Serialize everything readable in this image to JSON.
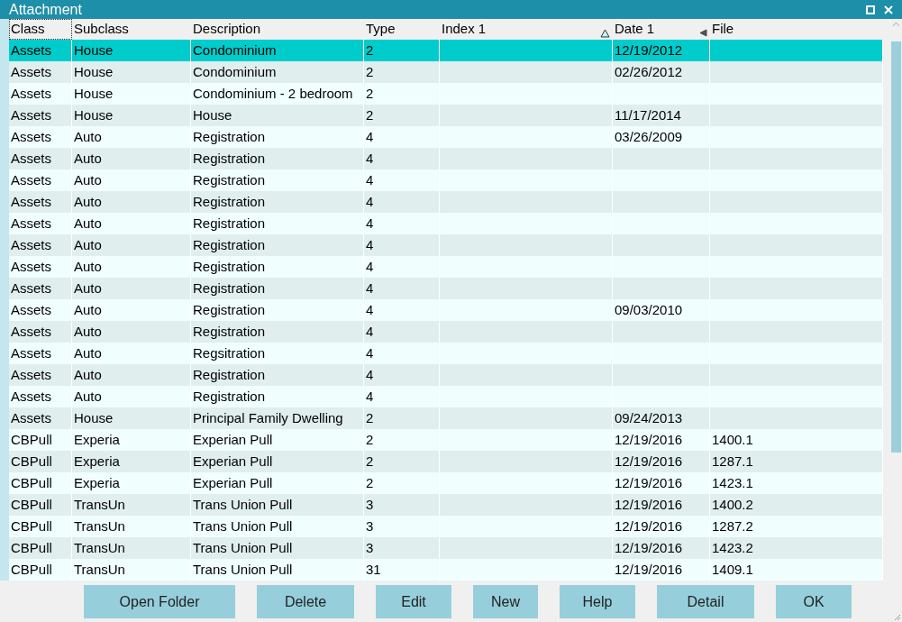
{
  "window": {
    "title": "Attachment"
  },
  "table": {
    "columns": [
      {
        "label": "Class",
        "sorted_ascending": false,
        "marked": false
      },
      {
        "label": "Subclass",
        "sorted_ascending": false,
        "marked": false
      },
      {
        "label": "Description",
        "sorted_ascending": false,
        "marked": false
      },
      {
        "label": "Type",
        "sorted_ascending": false,
        "marked": false
      },
      {
        "label": "Index 1",
        "sorted_ascending": true,
        "marked": false
      },
      {
        "label": "Date 1",
        "sorted_ascending": false,
        "marked": true
      },
      {
        "label": "File",
        "sorted_ascending": false,
        "marked": false
      }
    ],
    "rows": [
      {
        "selected": true,
        "cells": [
          "Assets",
          "House",
          "Condominium",
          "2",
          "",
          "12/19/2012",
          ""
        ]
      },
      {
        "selected": false,
        "cells": [
          "Assets",
          "House",
          "Condominium",
          "2",
          "",
          "02/26/2012",
          ""
        ]
      },
      {
        "selected": false,
        "cells": [
          "Assets",
          "House",
          "Condominium - 2 bedroom",
          "2",
          "",
          "",
          ""
        ]
      },
      {
        "selected": false,
        "cells": [
          "Assets",
          "House",
          "House",
          "2",
          "",
          "11/17/2014",
          ""
        ]
      },
      {
        "selected": false,
        "cells": [
          "Assets",
          "Auto",
          "Registration",
          "4",
          "",
          "03/26/2009",
          ""
        ]
      },
      {
        "selected": false,
        "cells": [
          "Assets",
          "Auto",
          "Registration",
          "4",
          "",
          "",
          ""
        ]
      },
      {
        "selected": false,
        "cells": [
          "Assets",
          "Auto",
          "Registration",
          "4",
          "",
          "",
          ""
        ]
      },
      {
        "selected": false,
        "cells": [
          "Assets",
          "Auto",
          "Registration",
          "4",
          "",
          "",
          ""
        ]
      },
      {
        "selected": false,
        "cells": [
          "Assets",
          "Auto",
          "Registration",
          "4",
          "",
          "",
          ""
        ]
      },
      {
        "selected": false,
        "cells": [
          "Assets",
          "Auto",
          "Registration",
          "4",
          "",
          "",
          ""
        ]
      },
      {
        "selected": false,
        "cells": [
          "Assets",
          "Auto",
          "Registration",
          "4",
          "",
          "",
          ""
        ]
      },
      {
        "selected": false,
        "cells": [
          "Assets",
          "Auto",
          "Registration",
          "4",
          "",
          "",
          ""
        ]
      },
      {
        "selected": false,
        "cells": [
          "Assets",
          "Auto",
          "Registration",
          "4",
          "",
          "09/03/2010",
          ""
        ]
      },
      {
        "selected": false,
        "cells": [
          "Assets",
          "Auto",
          "Registration",
          "4",
          "",
          "",
          ""
        ]
      },
      {
        "selected": false,
        "cells": [
          "Assets",
          "Auto",
          "Regsitration",
          "4",
          "",
          "",
          ""
        ]
      },
      {
        "selected": false,
        "cells": [
          "Assets",
          "Auto",
          "Registration",
          "4",
          "",
          "",
          ""
        ]
      },
      {
        "selected": false,
        "cells": [
          "Assets",
          "Auto",
          "Registration",
          "4",
          "",
          "",
          ""
        ]
      },
      {
        "selected": false,
        "cells": [
          "Assets",
          "House",
          "Principal Family Dwelling",
          "2",
          "",
          "09/24/2013",
          ""
        ]
      },
      {
        "selected": false,
        "cells": [
          "CBPull",
          "Experia",
          "Experian Pull",
          "2",
          "",
          "12/19/2016",
          "1400.1"
        ]
      },
      {
        "selected": false,
        "cells": [
          "CBPull",
          "Experia",
          "Experian Pull",
          "2",
          "",
          "12/19/2016",
          "1287.1"
        ]
      },
      {
        "selected": false,
        "cells": [
          "CBPull",
          "Experia",
          "Experian Pull",
          "2",
          "",
          "12/19/2016",
          "1423.1"
        ]
      },
      {
        "selected": false,
        "cells": [
          "CBPull",
          "TransUn",
          "Trans Union Pull",
          "3",
          "",
          "12/19/2016",
          "1400.2"
        ]
      },
      {
        "selected": false,
        "cells": [
          "CBPull",
          "TransUn",
          "Trans Union Pull",
          "3",
          "",
          "12/19/2016",
          "1287.2"
        ]
      },
      {
        "selected": false,
        "cells": [
          "CBPull",
          "TransUn",
          "Trans Union Pull",
          "3",
          "",
          "12/19/2016",
          "1423.2"
        ]
      },
      {
        "selected": false,
        "cells": [
          "CBPull",
          "TransUn",
          "Trans Union Pull",
          "31",
          "",
          "12/19/2016",
          "1409.1"
        ]
      }
    ]
  },
  "buttons": [
    "Open Folder",
    "Delete",
    "Edit",
    "New",
    "Help",
    "Detail",
    "OK"
  ]
}
